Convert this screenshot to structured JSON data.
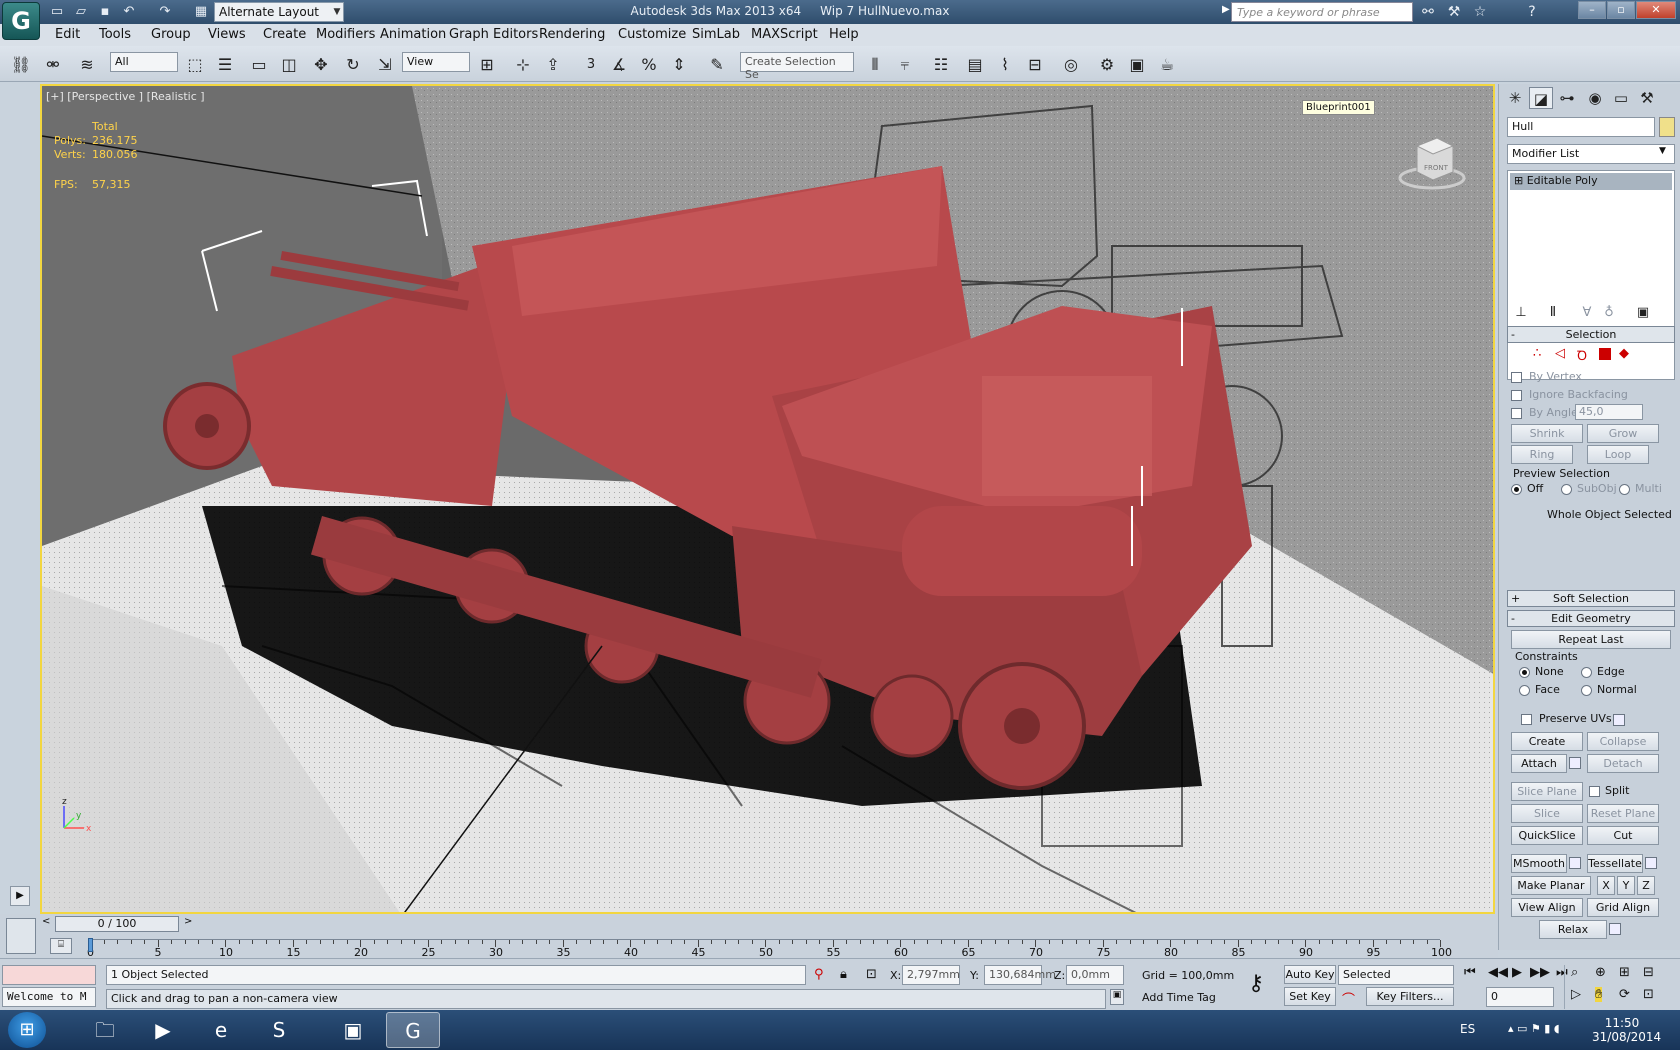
{
  "title": {
    "workspace": "Alternate Layout",
    "app_title": "Autodesk 3ds Max  2013 x64",
    "file": "Wip 7 HullNuevo.max",
    "search_placeholder": "Type a keyword or phrase"
  },
  "menu": [
    "Edit",
    "Tools",
    "Group",
    "Views",
    "Create",
    "Modifiers",
    "Animation",
    "Graph Editors",
    "Rendering",
    "Customize",
    "SimLab",
    "MAXScript",
    "Help"
  ],
  "toolbar": {
    "selection_filter": "All",
    "ref_coord": "View",
    "snap_count": "3",
    "named_selection": "Create Selection Se"
  },
  "viewport": {
    "label": "[+] [Perspective ] [Realistic ]",
    "stats_header": "Total",
    "polys_label": "Polys:",
    "polys_value": "236.175",
    "verts_label": "Verts:",
    "verts_value": "180.056",
    "fps_label": "FPS:",
    "fps_value": "57,315",
    "tooltip": "Blueprint001",
    "viewcube_face": "FRONT"
  },
  "cmdpanel": {
    "object_name": "Hull",
    "modifier_list": "Modifier List",
    "stack_item": "Editable Poly",
    "selection": {
      "header": "Selection",
      "by_vertex": "By Vertex",
      "ignore_backfacing": "Ignore Backfacing",
      "by_angle": "By Angle:",
      "angle_value": "45,0",
      "shrink": "Shrink",
      "grow": "Grow",
      "ring": "Ring",
      "loop": "Loop",
      "preview_header": "Preview Selection",
      "off": "Off",
      "subobj": "SubObj",
      "multi": "Multi",
      "status": "Whole Object Selected"
    },
    "soft_selection": "Soft Selection",
    "edit_geometry": {
      "header": "Edit Geometry",
      "repeat_last": "Repeat Last",
      "constraints": "Constraints",
      "none": "None",
      "edge": "Edge",
      "face": "Face",
      "normal": "Normal",
      "preserve_uvs": "Preserve UVs",
      "create": "Create",
      "collapse": "Collapse",
      "attach": "Attach",
      "detach": "Detach",
      "slice_plane": "Slice Plane",
      "split": "Split",
      "slice": "Slice",
      "reset_plane": "Reset Plane",
      "quickslice": "QuickSlice",
      "cut": "Cut",
      "msmooth": "MSmooth",
      "tessellate": "Tessellate",
      "make_planar": "Make Planar",
      "x": "X",
      "y": "Y",
      "z": "Z",
      "view_align": "View Align",
      "grid_align": "Grid Align",
      "relax": "Relax"
    }
  },
  "timeline": {
    "slider": "0 / 100",
    "ticks": [
      "0",
      "5",
      "10",
      "15",
      "20",
      "25",
      "30",
      "35",
      "40",
      "45",
      "50",
      "55",
      "60",
      "65",
      "70",
      "75",
      "80",
      "85",
      "90",
      "95",
      "100"
    ]
  },
  "status": {
    "listener": "Welcome to M",
    "selected": "1 Object Selected",
    "prompt": "Click and drag to pan a non-camera view",
    "x_label": "X:",
    "x_value": "2,797mm",
    "y_label": "Y:",
    "y_value": "130,684mm",
    "z_label": "Z:",
    "z_value": "0,0mm",
    "grid": "Grid = 100,0mm",
    "add_time_tag": "Add Time Tag",
    "auto_key": "Auto Key",
    "set_key": "Set Key",
    "key_mode": "Selected",
    "key_filters": "Key Filters...",
    "frame": "0"
  },
  "taskbar": {
    "language": "ES",
    "time": "11:50",
    "date": "31/08/2014"
  },
  "colors": {
    "hull": "#b3474b",
    "viewport_border": "#f2d640",
    "stats": "#ffd34a"
  }
}
